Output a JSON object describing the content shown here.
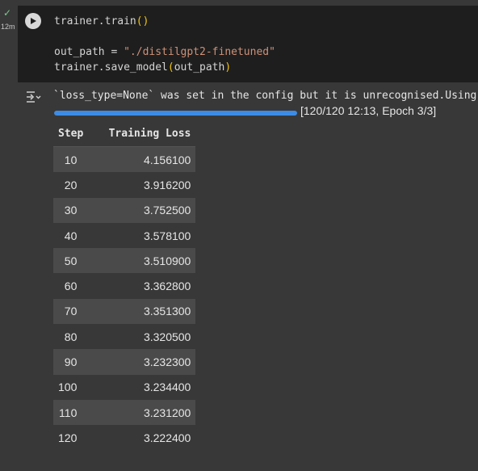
{
  "cell": {
    "status_time": "12m",
    "code_lines": [
      {
        "segments": [
          {
            "t": "trainer.train",
            "c": ""
          },
          {
            "t": "()",
            "c": "paren"
          }
        ]
      },
      {
        "segments": [
          {
            "t": "",
            "c": ""
          }
        ]
      },
      {
        "segments": [
          {
            "t": "out_path = ",
            "c": ""
          },
          {
            "t": "\"./distilgpt2-finetuned\"",
            "c": "str"
          }
        ]
      },
      {
        "segments": [
          {
            "t": "trainer.save_model",
            "c": ""
          },
          {
            "t": "(",
            "c": "paren"
          },
          {
            "t": "out_path",
            "c": ""
          },
          {
            "t": ")",
            "c": "paren"
          }
        ]
      }
    ]
  },
  "output": {
    "warning_text": "`loss_type=None` was set in the config but it is unrecognised.Using the default loss: ForCausalLMLoss.",
    "progress": {
      "fraction": 1.0,
      "label": "[120/120 12:13, Epoch 3/3]"
    },
    "table": {
      "headers": [
        "Step",
        "Training Loss"
      ],
      "rows": [
        [
          "10",
          "4.156100"
        ],
        [
          "20",
          "3.916200"
        ],
        [
          "30",
          "3.752500"
        ],
        [
          "40",
          "3.578100"
        ],
        [
          "50",
          "3.510900"
        ],
        [
          "60",
          "3.362800"
        ],
        [
          "70",
          "3.351300"
        ],
        [
          "80",
          "3.320500"
        ],
        [
          "90",
          "3.232300"
        ],
        [
          "100",
          "3.234400"
        ],
        [
          "110",
          "3.231200"
        ],
        [
          "120",
          "3.222400"
        ]
      ]
    }
  },
  "colors": {
    "background": "#383838",
    "code_bg": "#1e1e1e",
    "progress_fill": "#3c8ce7",
    "check": "#7cc98a"
  }
}
